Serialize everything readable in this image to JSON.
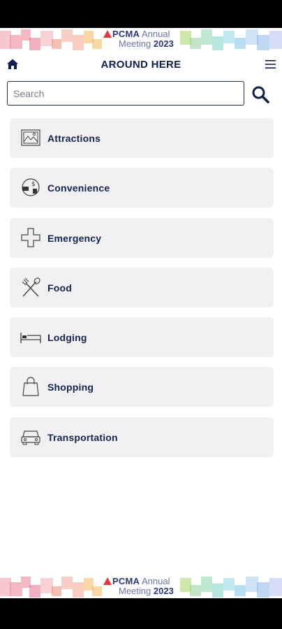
{
  "banner": {
    "brand": "PCMA",
    "line1_rest": " Annual",
    "line2_pre": "Meeting ",
    "year": "2023"
  },
  "header": {
    "title": "AROUND HERE",
    "home_icon": "home-icon",
    "menu_icon": "hamburger-menu-icon"
  },
  "search": {
    "placeholder": "Search",
    "value": "",
    "button_icon": "search-icon"
  },
  "categories": [
    {
      "label": "Attractions",
      "icon": "landscape-picture-icon"
    },
    {
      "label": "Convenience",
      "icon": "atm-money-icon"
    },
    {
      "label": "Emergency",
      "icon": "medical-cross-icon"
    },
    {
      "label": "Food",
      "icon": "fork-knife-icon"
    },
    {
      "label": "Lodging",
      "icon": "bed-icon"
    },
    {
      "label": "Shopping",
      "icon": "shopping-bag-icon"
    },
    {
      "label": "Transportation",
      "icon": "car-icon"
    }
  ],
  "colors": {
    "primary": "#0f1f4b",
    "item_background": "#f1f1f3",
    "search_border": "#1c2a52"
  }
}
